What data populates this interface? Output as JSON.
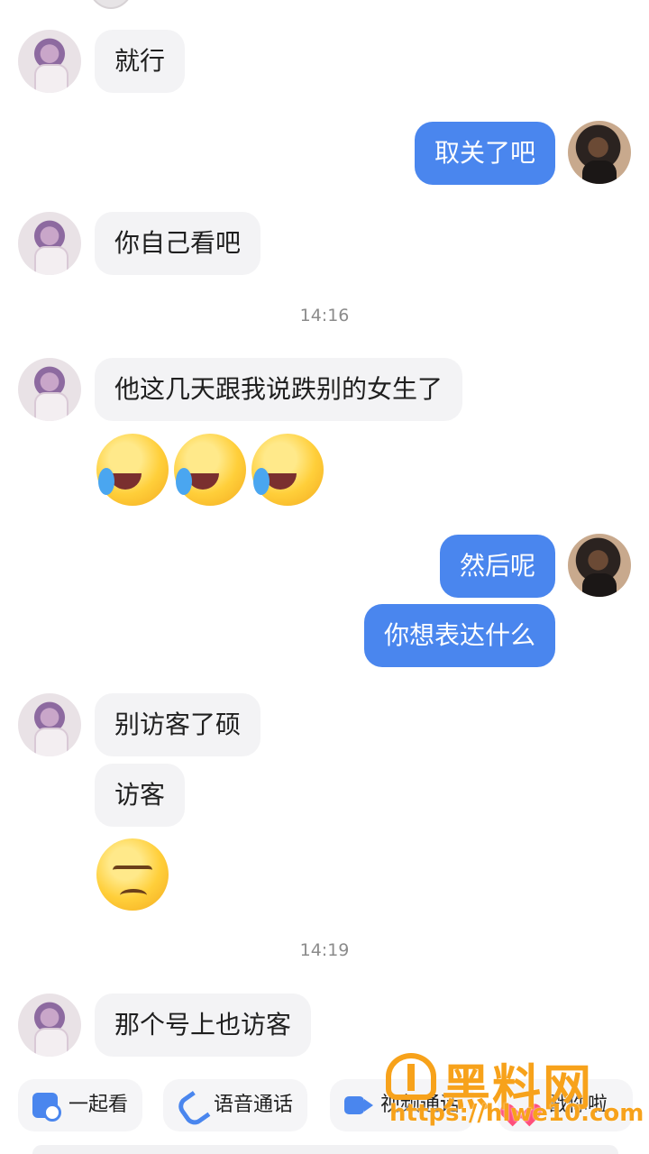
{
  "messages": [
    {
      "side": "in",
      "text": "就行"
    },
    {
      "side": "out",
      "text": "取关了吧"
    },
    {
      "side": "in",
      "text": "你自己看吧"
    },
    {
      "side": "in",
      "text": "他这几天跟我说跌别的女生了"
    },
    {
      "side": "out",
      "text": "然后呢"
    },
    {
      "side": "out",
      "text": "你想表达什么"
    },
    {
      "side": "in",
      "text": "别访客了硕"
    },
    {
      "side": "in",
      "text": "访客"
    },
    {
      "side": "in",
      "text": "那个号上也访客"
    }
  ],
  "timestamps": [
    "14:16",
    "14:19"
  ],
  "emojis": {
    "laugh_cry": "face-with-tears-of-joy-icon",
    "smirk": "unamused-face-icon"
  },
  "toolbar": {
    "watch_together": "一起看",
    "voice_call": "语音通话",
    "video_call": "视频通话",
    "poke": "戳你啦"
  },
  "watermark": {
    "title": "黑料网",
    "url": "https://hlwe10.com"
  },
  "colors": {
    "outgoing_bubble": "#4a86ee",
    "incoming_bubble": "#f3f3f5",
    "watermark": "#f7a21b"
  }
}
